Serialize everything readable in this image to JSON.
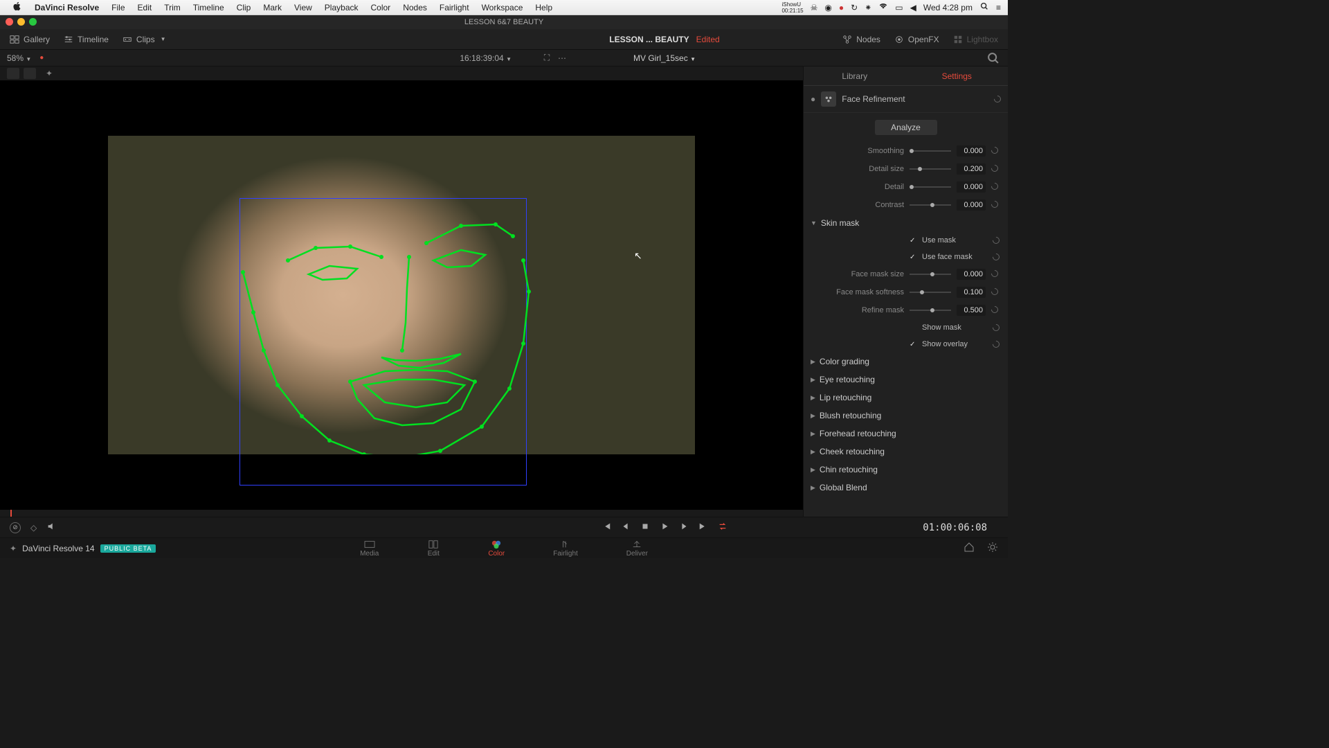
{
  "menubar": {
    "app_icon": "apple",
    "appname": "DaVinci Resolve",
    "items": [
      "File",
      "Edit",
      "Trim",
      "Timeline",
      "Clip",
      "Mark",
      "View",
      "Playback",
      "Color",
      "Nodes",
      "Fairlight",
      "Workspace",
      "Help"
    ],
    "right_info1": "iShowU",
    "right_info2": "00:21:15",
    "clock": "Wed 4:28 pm"
  },
  "window": {
    "title": "LESSON 6&7 BEAUTY"
  },
  "toolbar": {
    "gallery": "Gallery",
    "timeline": "Timeline",
    "clips": "Clips",
    "title": "LESSON ... BEAUTY",
    "edited": "Edited",
    "nodes": "Nodes",
    "openfx": "OpenFX",
    "lightbox": "Lightbox"
  },
  "subbar": {
    "zoom": "58%",
    "clipname": "MV Girl_15sec",
    "timecode": "16:18:39:04"
  },
  "panel": {
    "tabs": {
      "library": "Library",
      "settings": "Settings"
    },
    "fx_name": "Face Refinement",
    "analyze": "Analyze",
    "texture": {
      "smoothing": {
        "label": "Smoothing",
        "value": "0.000",
        "pos": 0
      },
      "detail_size": {
        "label": "Detail size",
        "value": "0.200",
        "pos": 20
      },
      "detail": {
        "label": "Detail",
        "value": "0.000",
        "pos": 0
      },
      "contrast": {
        "label": "Contrast",
        "value": "0.000",
        "pos": 50
      }
    },
    "skin_mask": {
      "header": "Skin mask",
      "use_mask": "Use mask",
      "use_face_mask": "Use face mask",
      "face_mask_size": {
        "label": "Face mask size",
        "value": "0.000",
        "pos": 50
      },
      "face_mask_softness": {
        "label": "Face mask softness",
        "value": "0.100",
        "pos": 25
      },
      "refine_mask": {
        "label": "Refine mask",
        "value": "0.500",
        "pos": 50
      },
      "show_mask": "Show mask",
      "show_overlay": "Show overlay"
    },
    "sections": [
      "Color grading",
      "Eye retouching",
      "Lip retouching",
      "Blush retouching",
      "Forehead retouching",
      "Cheek retouching",
      "Chin retouching",
      "Global Blend"
    ]
  },
  "transport": {
    "timecode": "01:00:06:08"
  },
  "bottom_nav": {
    "appver": "DaVinci Resolve 14",
    "beta": "PUBLIC BETA",
    "items": [
      "Media",
      "Edit",
      "Color",
      "Fairlight",
      "Deliver"
    ],
    "active": "Color"
  }
}
